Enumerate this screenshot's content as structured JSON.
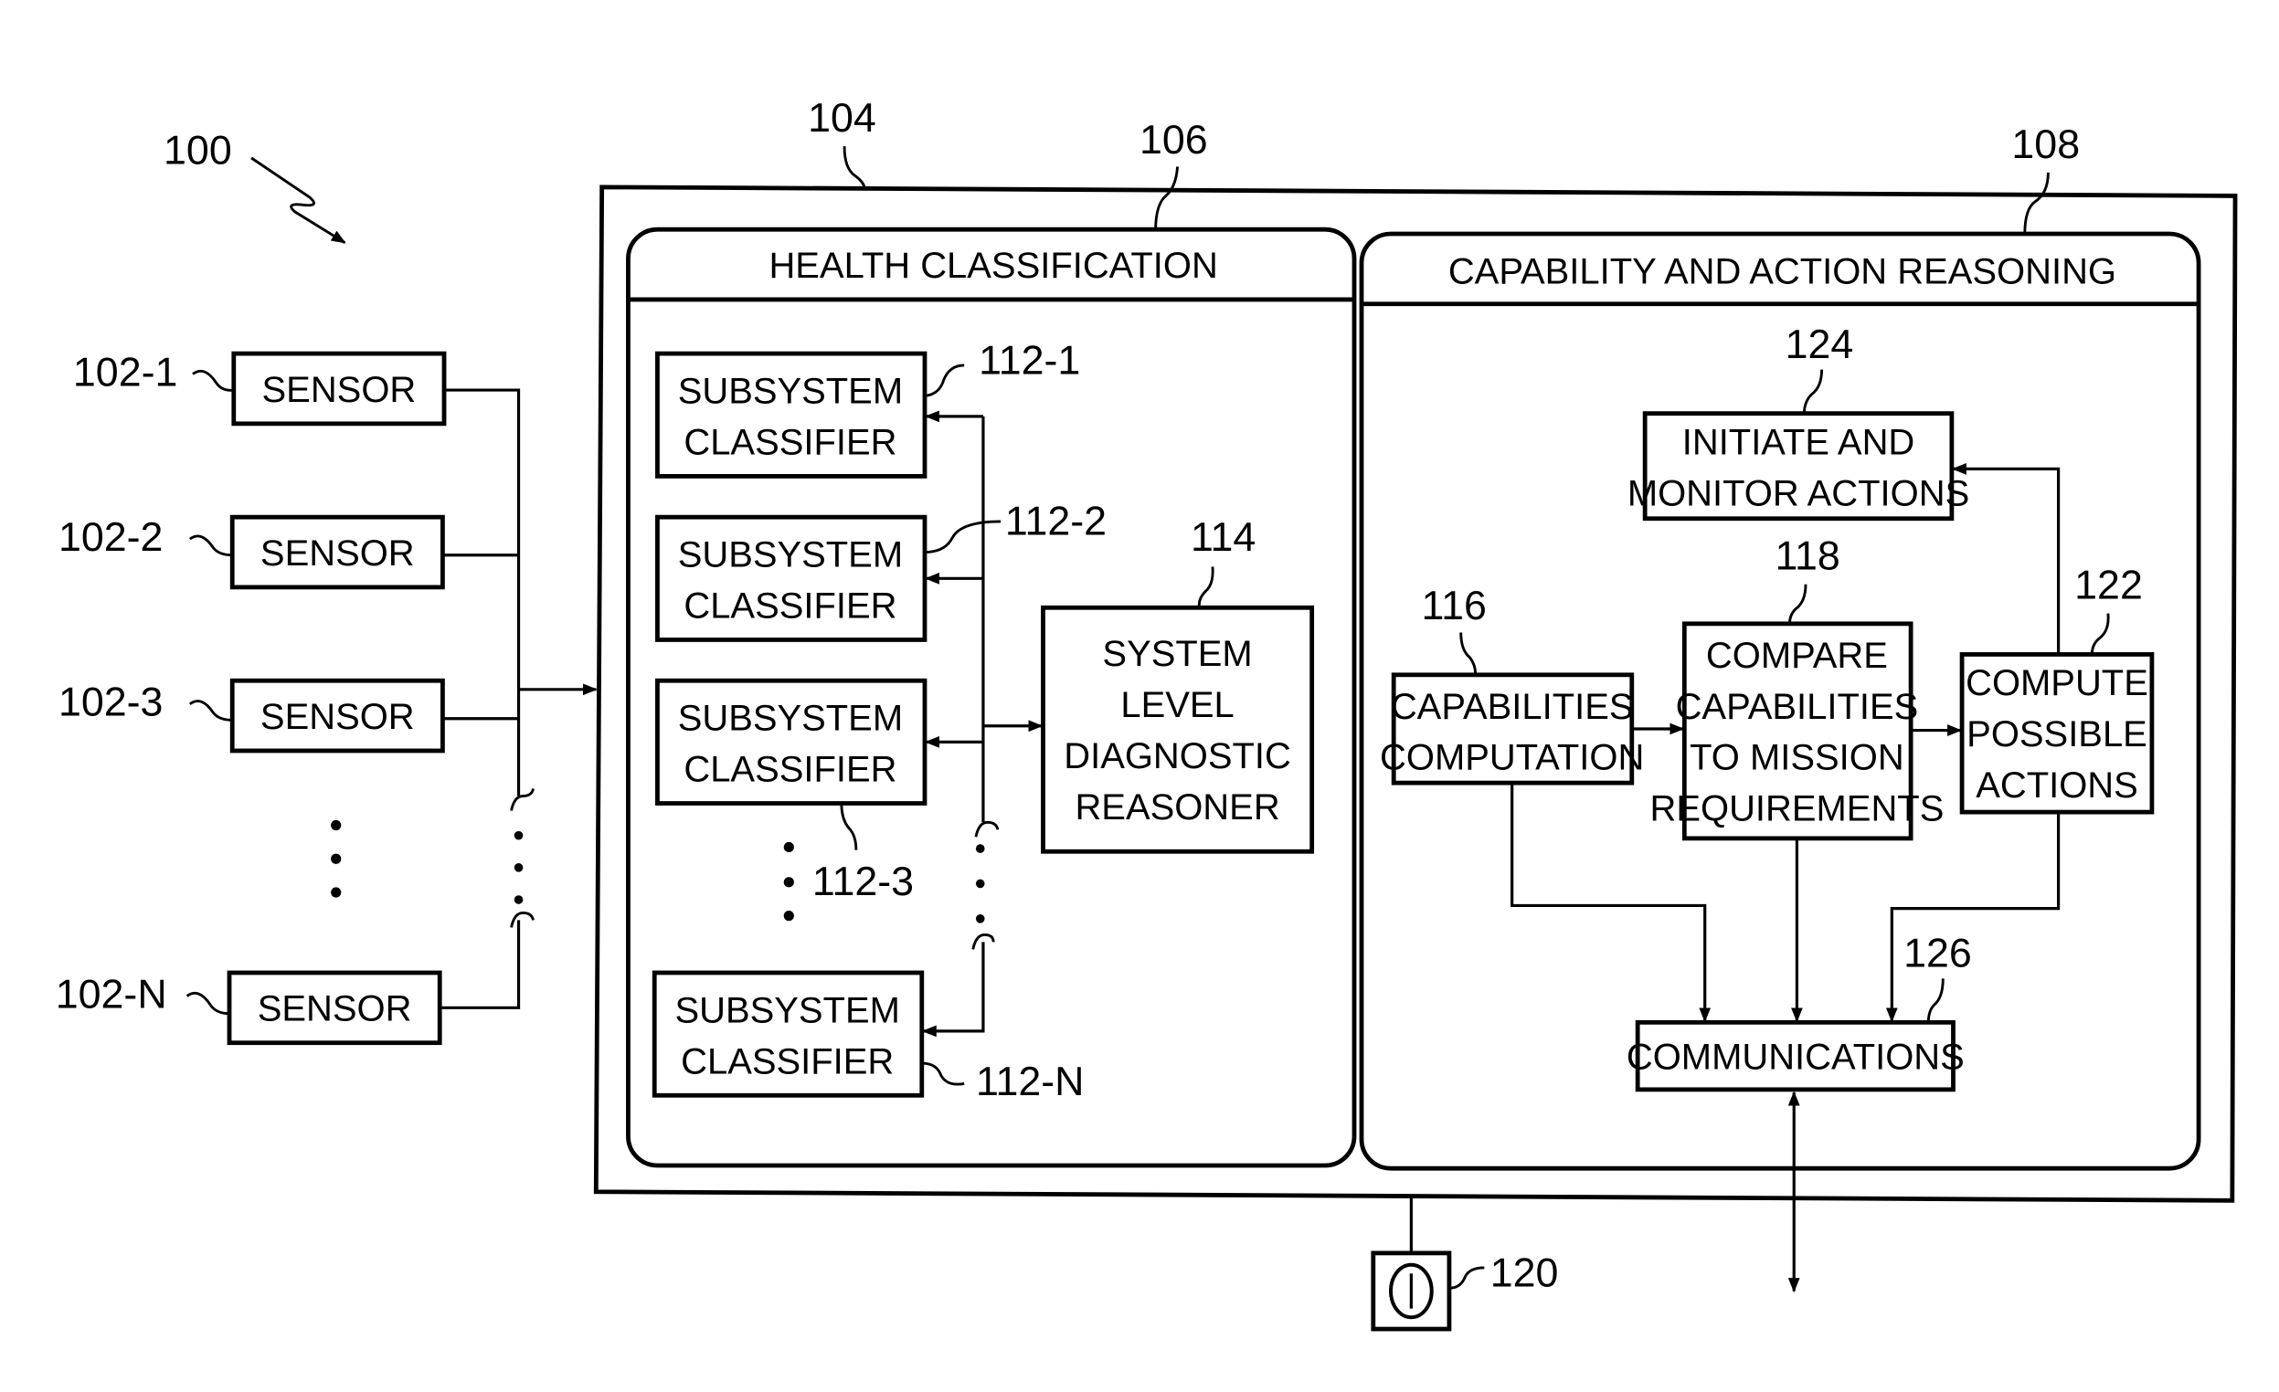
{
  "figure": {
    "ref": "100",
    "outer_ref": "104",
    "power_ref": "120",
    "power_symbol": "power-switch-icon"
  },
  "sensors": [
    {
      "ref": "102-1",
      "label": "SENSOR"
    },
    {
      "ref": "102-2",
      "label": "SENSOR"
    },
    {
      "ref": "102-3",
      "label": "SENSOR"
    },
    {
      "ref": "102-N",
      "label": "SENSOR"
    }
  ],
  "health_panel": {
    "ref": "106",
    "title": "HEALTH CLASSIFICATION",
    "classifiers": [
      {
        "ref": "112-1",
        "line1": "SUBSYSTEM",
        "line2": "CLASSIFIER"
      },
      {
        "ref": "112-2",
        "line1": "SUBSYSTEM",
        "line2": "CLASSIFIER"
      },
      {
        "ref": "112-3",
        "line1": "SUBSYSTEM",
        "line2": "CLASSIFIER"
      },
      {
        "ref": "112-N",
        "line1": "SUBSYSTEM",
        "line2": "CLASSIFIER"
      }
    ],
    "reasoner": {
      "ref": "114",
      "lines": [
        "SYSTEM",
        "LEVEL",
        "DIAGNOSTIC",
        "REASONER"
      ]
    }
  },
  "capability_panel": {
    "ref": "108",
    "title": "CAPABILITY AND ACTION REASONING",
    "initiate": {
      "ref": "124",
      "lines": [
        "INITIATE AND",
        "MONITOR ACTIONS"
      ]
    },
    "capabilities": {
      "ref": "116",
      "lines": [
        "CAPABILITIES",
        "COMPUTATION"
      ]
    },
    "compare": {
      "ref": "118",
      "lines": [
        "COMPARE",
        "CAPABILITIES",
        "TO MISSION",
        "REQUIREMENTS"
      ]
    },
    "compute": {
      "ref": "122",
      "lines": [
        "COMPUTE",
        "POSSIBLE",
        "ACTIONS"
      ]
    },
    "communications": {
      "ref": "126",
      "label": "COMMUNICATIONS"
    }
  }
}
